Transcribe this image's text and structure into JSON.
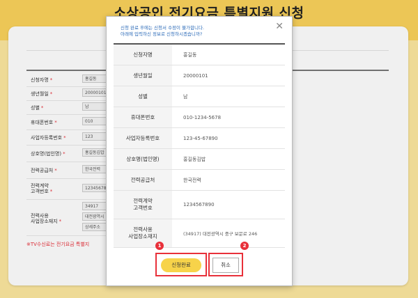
{
  "page": {
    "title": "소상공인 전기요금 특별지원 신청"
  },
  "form": {
    "rows": [
      {
        "label": "신청자명",
        "value": "홍길동"
      },
      {
        "label": "생년월일",
        "value": "20000101"
      },
      {
        "label": "성별",
        "value": "남"
      },
      {
        "label": "휴대폰번호",
        "value": "010"
      },
      {
        "label": "사업자등록번호",
        "value": "123"
      },
      {
        "label": "상호명(법인명)",
        "value": "홍길동김밥"
      },
      {
        "label": "전력공급처",
        "value": "한국전력"
      },
      {
        "label": "전력계약\n고객번호",
        "value": "1234567890"
      },
      {
        "label": "전력사용\n사업장소재지",
        "value": "34917",
        "value2": "대전광역시",
        "value3": "상세주소"
      }
    ],
    "required_mark": "*",
    "tv_notice": "※TV수신료는 전기요금 특별지"
  },
  "modal": {
    "notice_line1": "신청 완료 후에는 신청서 수정이 불가합니다.",
    "notice_line2": "아래에 입력하신 정보로 신청하시겠습니까?",
    "close_label": "✕",
    "rows": [
      {
        "label": "신청자명",
        "value": "홍길동"
      },
      {
        "label": "생년월일",
        "value": "20000101"
      },
      {
        "label": "성별",
        "value": "남"
      },
      {
        "label": "휴대폰번호",
        "value": "010-1234-5678"
      },
      {
        "label": "사업자등록번호",
        "value": "123-45-67890"
      },
      {
        "label": "상호명(법인명)",
        "value": "홍길동김밥"
      },
      {
        "label": "전력공급처",
        "value": "한국전력"
      },
      {
        "label": "전력계약\n고객번호",
        "value": "1234567890"
      },
      {
        "label": "전력사용\n사업장소재지",
        "value": "(34917) 대전광역시 중구 보문로 246"
      }
    ],
    "submit_label": "신청완료",
    "cancel_label": "취소",
    "badge1": "1",
    "badge2": "2",
    "accent_color": "#e8303a",
    "button_color": "#f7d34a"
  }
}
